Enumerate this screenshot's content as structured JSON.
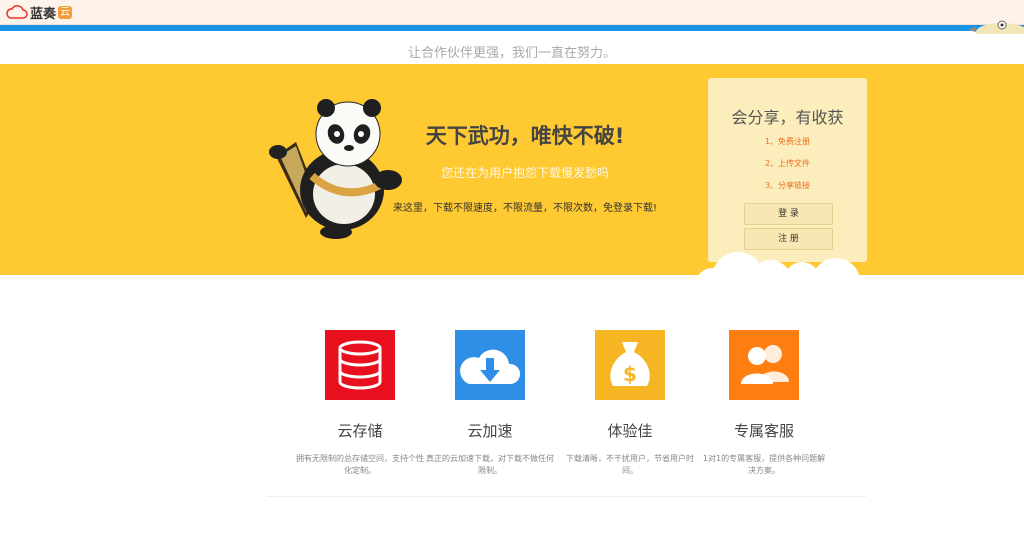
{
  "header": {
    "logo_text": "蓝奏",
    "logo_badge": "云"
  },
  "slogan": "让合作伙伴更强，我们一直在努力。",
  "banner": {
    "headline": "天下武功，唯快不破!",
    "subheadline": "您还在为用户抱怨下载慢发愁吗",
    "description": "来这里，下载不限速度，不限流量，不限次数，免登录下载!"
  },
  "share_box": {
    "title": "会分享，有收获",
    "steps": [
      "1、免费注册",
      "2、上传文件",
      "3、分享链接"
    ],
    "login_label": "登 录",
    "register_label": "注 册"
  },
  "features": [
    {
      "title": "云存储",
      "desc": "拥有无限制的总存储空间，支持个性化定制。"
    },
    {
      "title": "云加速",
      "desc": "真正的云加速下载，对下载不做任何限制。"
    },
    {
      "title": "体验佳",
      "desc": "下载清晰，不干扰用户，节省用户时间。"
    },
    {
      "title": "专属客服",
      "desc": "1对1的专属客服，提供各种问题解决方案。"
    }
  ],
  "colors": {
    "banner": "#fec931",
    "topbar": "#1793e6",
    "storage_icon": "#e8101e",
    "speed_icon": "#2f8fe6",
    "experience_icon": "#f6b623",
    "service_icon": "#ff7e11"
  }
}
